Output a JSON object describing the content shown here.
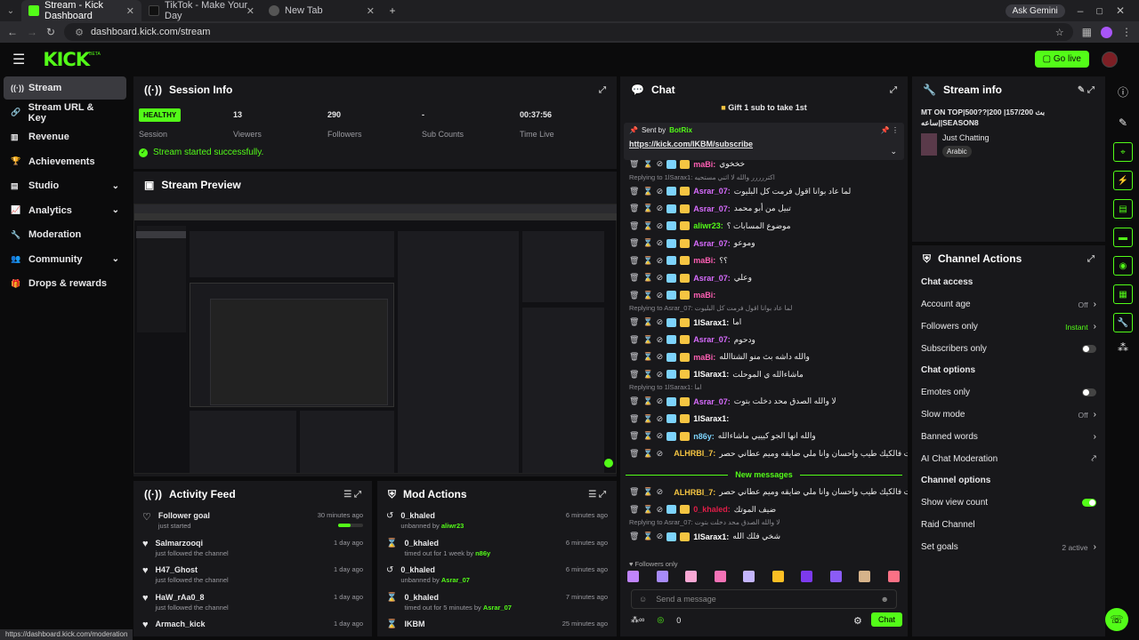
{
  "browser": {
    "tabs": [
      {
        "title": "Stream - Kick Dashboard",
        "active": true,
        "favicon_color": "#53fc18"
      },
      {
        "title": "TikTok - Make Your Day",
        "active": false,
        "favicon_color": "#111111"
      },
      {
        "title": "New Tab",
        "active": false,
        "favicon_color": "#555555"
      }
    ],
    "new_tab": "+",
    "gemini": "Ask Gemini",
    "url": "dashboard.kick.com/stream",
    "status_url": "https://dashboard.kick.com/moderation"
  },
  "topnav": {
    "logo": "KICK",
    "logo_sup": "BETA",
    "go_live": "Go live"
  },
  "sidebar": {
    "items": [
      {
        "label": "Stream",
        "icon": "stream-icon",
        "glyph": "((·))",
        "active": true,
        "chevron": ""
      },
      {
        "label": "Stream URL & Key",
        "icon": "link-icon",
        "glyph": "🔗",
        "chevron": ""
      },
      {
        "label": "Revenue",
        "icon": "chart-icon",
        "glyph": "▥",
        "chevron": ""
      },
      {
        "label": "Achievements",
        "icon": "trophy-icon",
        "glyph": "🏆",
        "chevron": ""
      },
      {
        "label": "Studio",
        "icon": "studio-icon",
        "glyph": "▤",
        "chevron": "⌄"
      },
      {
        "label": "Analytics",
        "icon": "analytics-icon",
        "glyph": "📈",
        "chevron": "⌄"
      },
      {
        "label": "Moderation",
        "icon": "wrench-icon",
        "glyph": "🔧",
        "chevron": ""
      },
      {
        "label": "Community",
        "icon": "community-icon",
        "glyph": "👥",
        "chevron": "⌄"
      },
      {
        "label": "Drops & rewards",
        "icon": "gift-icon",
        "glyph": "🎁",
        "chevron": ""
      }
    ]
  },
  "session": {
    "title": "Session Info",
    "health": "HEALTHY",
    "stats": [
      {
        "value": "",
        "label": "Session"
      },
      {
        "value": "13",
        "label": "Viewers"
      },
      {
        "value": "290",
        "label": "Followers"
      },
      {
        "value": "-",
        "label": "Sub Counts"
      },
      {
        "value": "00:37:56",
        "label": "Time Live"
      }
    ],
    "started": "Stream started successfully."
  },
  "preview": {
    "title": "Stream Preview"
  },
  "activity": {
    "title": "Activity Feed",
    "items": [
      {
        "name": "Follower goal",
        "sub": "just started",
        "time": "30 minutes ago",
        "progress": 0.5
      },
      {
        "name": "Salmarzooqi",
        "sub": "just followed the channel",
        "time": "1 day ago"
      },
      {
        "name": "H47_Ghost",
        "sub": "just followed the channel",
        "time": "1 day ago"
      },
      {
        "name": "HaW_rAa0_8",
        "sub": "just followed the channel",
        "time": "1 day ago"
      },
      {
        "name": "Armach_kick",
        "sub": "",
        "time": "1 day ago"
      }
    ]
  },
  "mod": {
    "title": "Mod Actions",
    "items": [
      {
        "name": "0_khaled",
        "action": "unbanned by",
        "by": "aliwr23",
        "time": "6 minutes ago",
        "icon": "undo-icon",
        "glyph": "↺"
      },
      {
        "name": "0_khaled",
        "action": "timed out for 1 week by",
        "by": "n86y",
        "time": "6 minutes ago",
        "icon": "hourglass-icon",
        "glyph": "⌛"
      },
      {
        "name": "0_khaled",
        "action": "unbanned by",
        "by": "Asrar_07",
        "time": "6 minutes ago",
        "icon": "undo-icon",
        "glyph": "↺"
      },
      {
        "name": "0_khaled",
        "action": "timed out for 5 minutes by",
        "by": "Asrar_07",
        "time": "7 minutes ago",
        "icon": "hourglass-icon",
        "glyph": "⌛"
      },
      {
        "name": "IKBM",
        "action": "",
        "by": "",
        "time": "25 minutes ago",
        "icon": "hourglass-icon",
        "glyph": "⌛"
      }
    ]
  },
  "chat": {
    "title": "Chat",
    "gift_banner": "Gift 1 sub to take 1st",
    "pinned_by": "Sent by",
    "pinned_user": "BotRix",
    "pinned_link": "https://kick.com/IKBM/subscribe",
    "new_messages": "New messages",
    "followers_only": "Followers only",
    "placeholder": "Send a message",
    "send": "Chat",
    "count": "0",
    "lines": [
      {
        "reply": "",
        "user": "maBi:",
        "color": "#ff5fb4",
        "text": "خخخوي"
      },
      {
        "reply": "Replying to 1lSarax1: اكتررررر والله لا اثني مستحيه",
        "user": "",
        "color": "",
        "text": ""
      },
      {
        "reply": "",
        "user": "Asrar_07:",
        "color": "#d86cff",
        "text": "لما عاد بوانا اقول فرمت كل البليوت"
      },
      {
        "reply": "",
        "user": "Asrar_07:",
        "color": "#d86cff",
        "text": "تبيل من أبو محمد"
      },
      {
        "reply": "",
        "user": "aliwr23:",
        "color": "#53fc18",
        "text": "موضوع المسابات ؟"
      },
      {
        "reply": "",
        "user": "Asrar_07:",
        "color": "#d86cff",
        "text": "وموعو"
      },
      {
        "reply": "",
        "user": "maBi:",
        "color": "#ff5fb4",
        "text": "؟؟"
      },
      {
        "reply": "",
        "user": "Asrar_07:",
        "color": "#d86cff",
        "text": "وعلي"
      },
      {
        "reply": "",
        "user": "maBi:",
        "color": "#ff5fb4",
        "text": ""
      },
      {
        "reply": "Replying to Asrar_07: لما عاد بوانا اقول فرمت كل البليوت",
        "user": "",
        "color": "",
        "text": ""
      },
      {
        "reply": "",
        "user": "1lSarax1:",
        "color": "#ffffff",
        "text": "اما"
      },
      {
        "reply": "",
        "user": "Asrar_07:",
        "color": "#d86cff",
        "text": "ودحوم"
      },
      {
        "reply": "",
        "user": "maBi:",
        "color": "#ff5fb4",
        "text": "والله داشه بث منو الشتاالله"
      },
      {
        "reply": "",
        "user": "1lSarax1:",
        "color": "#ffffff",
        "text": "ماشاءالله ي الموحلت"
      },
      {
        "reply": "Replying to 1lSarax1: اما",
        "user": "",
        "color": "",
        "text": ""
      },
      {
        "reply": "",
        "user": "Asrar_07:",
        "color": "#d86cff",
        "text": "لا والله الصدق محد دخلت بتوت"
      },
      {
        "reply": "",
        "user": "1lSarax1:",
        "color": "#ffffff",
        "text": ""
      },
      {
        "reply": "",
        "user": "n86y:",
        "color": "#7dd3fc",
        "text": "والله انها الجو كيييي ماشاءالله"
      },
      {
        "reply": "",
        "user": "ALHRBI_7:",
        "color": "#f5c542",
        "text": "انا عاندي خمسه حسابات فالكيك طيب واحسان وانا ملي ضايقه وميم عطاني حصر"
      }
    ],
    "lines2": [
      {
        "reply": "",
        "user": "ALHRBI_7:",
        "color": "#f5c542",
        "text": "انا عاندي خمسه حسابات فالكيك طيب واحسان وانا ملي ضايقه وميم عطاني حصر"
      },
      {
        "reply": "",
        "user": "0_khaled:",
        "color": "#e11d48",
        "text": "ضيف الموتك"
      },
      {
        "reply": "Replying to Asrar_07: لا والله الصدق محد دخلت بتوت",
        "user": "",
        "color": "",
        "text": ""
      },
      {
        "reply": "",
        "user": "1lSarax1:",
        "color": "#ffffff",
        "text": "شخي فلك الله"
      }
    ]
  },
  "streaminfo": {
    "title": "Stream info",
    "stream_title": "MT ON TOP|500??|200 بث 157/200|ساعه||SEASON8",
    "category": "Just Chatting",
    "tag": "Arabic"
  },
  "actions": {
    "title": "Channel Actions",
    "sections": [
      {
        "heading": "Chat access",
        "rows": [
          {
            "label": "Account age",
            "value": "Off",
            "control": "chevron"
          },
          {
            "label": "Followers only",
            "value": "Instant",
            "control": "chevron",
            "accent": true
          },
          {
            "label": "Subscribers only",
            "value": "",
            "control": "toggle-off"
          }
        ]
      },
      {
        "heading": "Chat options",
        "rows": [
          {
            "label": "Emotes only",
            "value": "",
            "control": "toggle-off"
          },
          {
            "label": "Slow mode",
            "value": "Off",
            "control": "chevron"
          },
          {
            "label": "Banned words",
            "value": "",
            "control": "chevron"
          },
          {
            "label": "AI Chat Moderation",
            "value": "",
            "control": "external"
          }
        ]
      },
      {
        "heading": "Channel options",
        "rows": [
          {
            "label": "Show view count",
            "value": "",
            "control": "toggle-on"
          },
          {
            "label": "Raid Channel",
            "value": "",
            "control": "none"
          },
          {
            "label": "Set goals",
            "value": "2 active",
            "control": "chevron"
          }
        ]
      }
    ]
  },
  "colors": {
    "accent": "#53fc18",
    "panel": "#18181b",
    "bg": "#0b0b0c"
  }
}
